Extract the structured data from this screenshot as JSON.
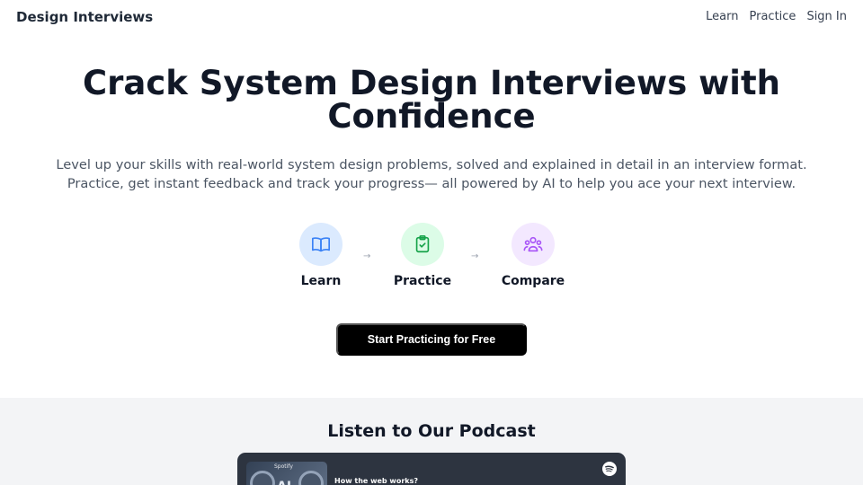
{
  "nav": {
    "brand": "Design Interviews",
    "links": [
      "Learn",
      "Practice",
      "Sign In"
    ]
  },
  "hero": {
    "title": "Crack System Design Interviews with Confidence",
    "subtitle_line1": "Level up your skills with real-world system design problems, solved and explained in detail in an interview format.",
    "subtitle_line2": "Practice, get instant feedback and track your progress— all powered by AI to help you ace your next interview."
  },
  "steps": [
    {
      "label": "Learn",
      "icon": "book-icon",
      "color": "#3b82f6",
      "bg": "#dbeafe"
    },
    {
      "label": "Practice",
      "icon": "clipboard-check-icon",
      "color": "#16a34a",
      "bg": "#dcfce7"
    },
    {
      "label": "Compare",
      "icon": "users-icon",
      "color": "#a855f7",
      "bg": "#f3e8ff"
    }
  ],
  "arrow_glyph": "→",
  "cta": {
    "label": "Start Practicing for Free"
  },
  "podcast": {
    "title": "Listen to Our Podcast",
    "episode_title": "How the web works?",
    "cover_text": "AI",
    "brand_tag": "Spotify"
  },
  "colors": {
    "cta_bg": "#000000",
    "podcast_bg": "#f3f4f6",
    "player_bg": "#2d3440"
  }
}
